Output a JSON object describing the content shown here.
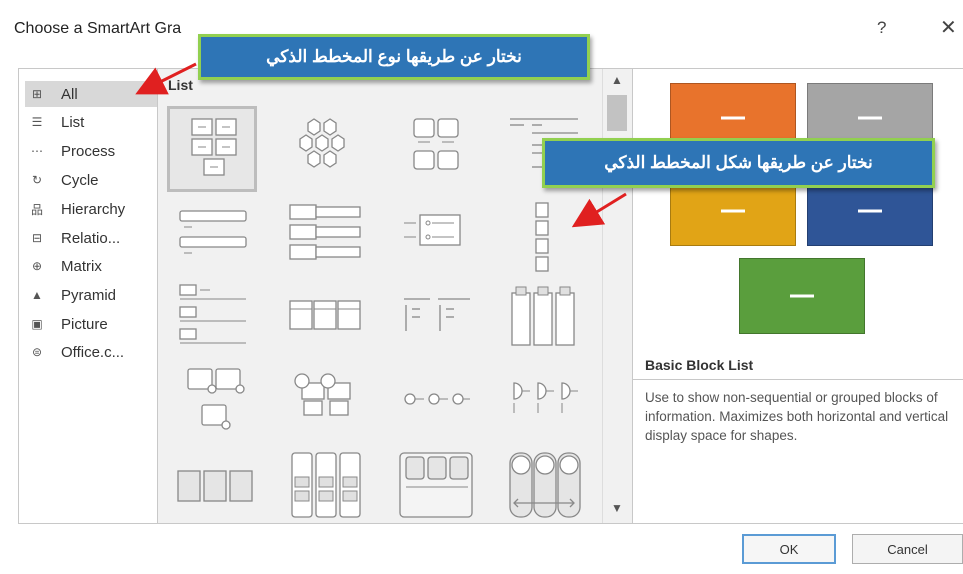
{
  "window": {
    "title": "Choose a SmartArt Gra",
    "help": "?",
    "close": "✕"
  },
  "categories": [
    {
      "label": "All",
      "icon": "all-icon",
      "glyph": "⊞"
    },
    {
      "label": "List",
      "icon": "list-icon",
      "glyph": "☰"
    },
    {
      "label": "Process",
      "icon": "process-icon",
      "glyph": "⋯"
    },
    {
      "label": "Cycle",
      "icon": "cycle-icon",
      "glyph": "↻"
    },
    {
      "label": "Hierarchy",
      "icon": "hierarchy-icon",
      "glyph": "品"
    },
    {
      "label": "Relatio...",
      "icon": "relationship-icon",
      "glyph": "⊟"
    },
    {
      "label": "Matrix",
      "icon": "matrix-icon",
      "glyph": "⊕"
    },
    {
      "label": "Pyramid",
      "icon": "pyramid-icon",
      "glyph": "▲"
    },
    {
      "label": "Picture",
      "icon": "picture-icon",
      "glyph": "▣"
    },
    {
      "label": "Office.c...",
      "icon": "office-icon",
      "glyph": "⊜"
    }
  ],
  "gallery": {
    "header": "List",
    "scroll_up": "▲",
    "scroll_down": "▼",
    "selected_index": 0
  },
  "preview": {
    "name": "Basic Block List",
    "description": "Use to show non-sequential or grouped blocks of information. Maximizes both horizontal and vertical display space for shapes.",
    "colors": [
      "#e8732c",
      "#a5a5a5",
      "#e1a416",
      "#2f5597",
      "#5a9e3d"
    ]
  },
  "buttons": {
    "ok": "OK",
    "cancel": "Cancel"
  },
  "annotations": {
    "type_note": "نختار عن طريقها نوع المخطط الذكي",
    "shape_note": "نختار عن طريقها شكل المخطط الذكي"
  },
  "colors": {
    "callout_bg": "#2e75b6",
    "callout_border": "#92d050",
    "arrow": "#e02020"
  }
}
